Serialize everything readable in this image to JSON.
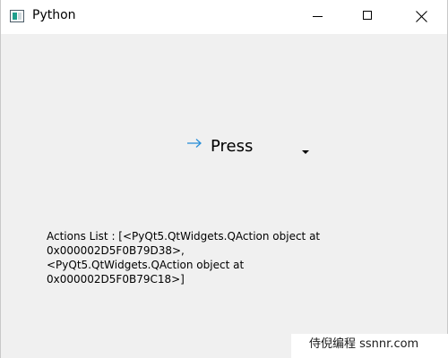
{
  "window": {
    "title": "Python"
  },
  "tool_button": {
    "label": "Press",
    "icon": "right-arrow-icon",
    "menu_indicator": "chevron-down-icon"
  },
  "actions_label": {
    "text": "Actions List : [<PyQt5.QtWidgets.QAction object at 0x000002D5F0B79D38>, <PyQt5.QtWidgets.QAction object at 0x000002D5F0B79C18>]"
  },
  "watermark": {
    "text": "侍倪编程 ssnnr.com"
  },
  "colors": {
    "client_background": "#f0f0f0",
    "titlebar_background": "#ffffff",
    "arrow_icon": "#2a8fd8"
  }
}
